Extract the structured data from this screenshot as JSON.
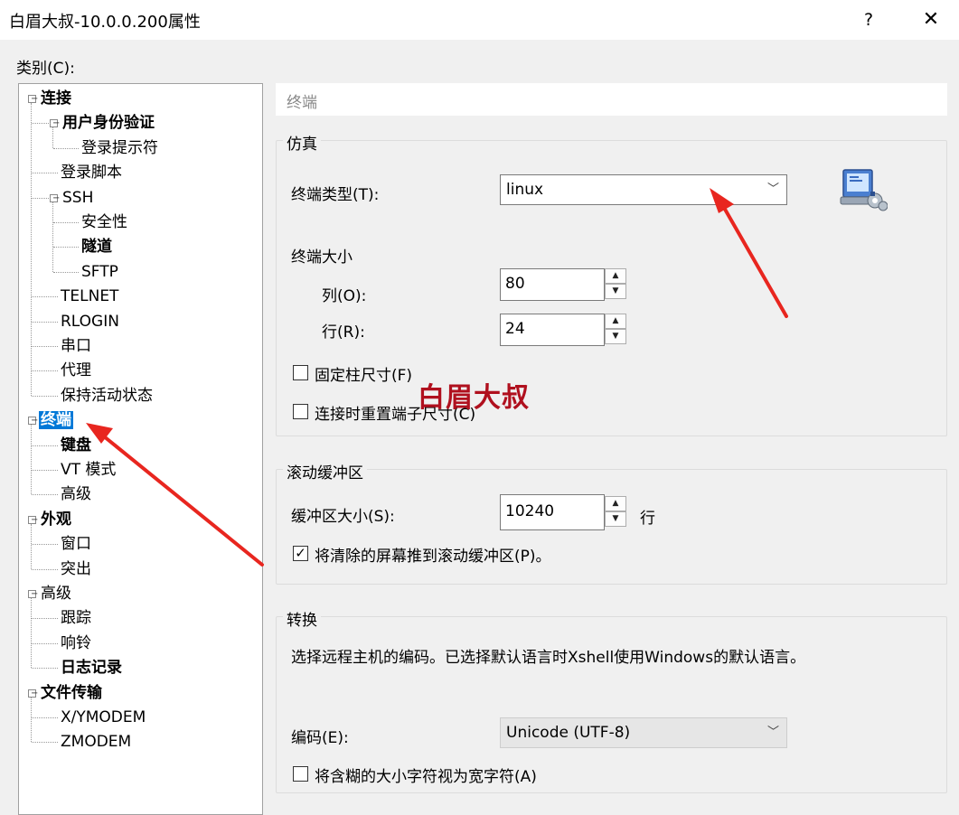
{
  "window": {
    "title": "白眉大叔-10.0.0.200属性",
    "help_label": "?",
    "close_label": "✕"
  },
  "category_label": "类别(C):",
  "tree": [
    {
      "label": "连接",
      "level": 0,
      "bold": true,
      "expander": "⊟"
    },
    {
      "label": "用户身份验证",
      "level": 1,
      "bold": true,
      "expander": "⊟"
    },
    {
      "label": "登录提示符",
      "level": 2,
      "bold": false
    },
    {
      "label": "登录脚本",
      "level": 1,
      "bold": false
    },
    {
      "label": "SSH",
      "level": 1,
      "bold": false,
      "expander": "⊟"
    },
    {
      "label": "安全性",
      "level": 2,
      "bold": false
    },
    {
      "label": "隧道",
      "level": 2,
      "bold": true
    },
    {
      "label": "SFTP",
      "level": 2,
      "bold": false
    },
    {
      "label": "TELNET",
      "level": 1,
      "bold": false
    },
    {
      "label": "RLOGIN",
      "level": 1,
      "bold": false
    },
    {
      "label": "串口",
      "level": 1,
      "bold": false
    },
    {
      "label": "代理",
      "level": 1,
      "bold": false
    },
    {
      "label": "保持活动状态",
      "level": 1,
      "bold": false
    },
    {
      "label": "终端",
      "level": 0,
      "bold": true,
      "expander": "⊟",
      "selected": true
    },
    {
      "label": "键盘",
      "level": 1,
      "bold": true
    },
    {
      "label": "VT 模式",
      "level": 1,
      "bold": false
    },
    {
      "label": "高级",
      "level": 1,
      "bold": false
    },
    {
      "label": "外观",
      "level": 0,
      "bold": true,
      "expander": "⊟"
    },
    {
      "label": "窗口",
      "level": 1,
      "bold": false
    },
    {
      "label": "突出",
      "level": 1,
      "bold": false
    },
    {
      "label": "高级",
      "level": 0,
      "bold": false,
      "expander": "⊟"
    },
    {
      "label": "跟踪",
      "level": 1,
      "bold": false
    },
    {
      "label": "响铃",
      "level": 1,
      "bold": false
    },
    {
      "label": "日志记录",
      "level": 1,
      "bold": true
    },
    {
      "label": "文件传输",
      "level": 0,
      "bold": true,
      "expander": "⊟"
    },
    {
      "label": "X/YMODEM",
      "level": 1,
      "bold": false
    },
    {
      "label": "ZMODEM",
      "level": 1,
      "bold": false
    }
  ],
  "panel": {
    "header": "终端",
    "emulation": {
      "group_title": "仿真",
      "terminal_type_label": "终端类型(T):",
      "terminal_type_value": "linux",
      "size_label": "终端大小",
      "cols_label": "列(O):",
      "cols_value": "80",
      "rows_label": "行(R):",
      "rows_value": "24",
      "fixed_cols_label": "固定柱尺寸(F)",
      "fixed_cols_checked": false,
      "reset_size_label": "连接时重置端子尺寸(C)",
      "reset_size_checked": false
    },
    "scrollback": {
      "group_title": "滚动缓冲区",
      "buffer_size_label": "缓冲区大小(S):",
      "buffer_size_value": "10240",
      "buffer_unit": "行",
      "push_cleared_label": "将清除的屏幕推到滚动缓冲区(P)。",
      "push_cleared_checked": true
    },
    "translation": {
      "group_title": "转换",
      "description": "选择远程主机的编码。已选择默认语言时Xshell使用Windows的默认语言。",
      "encoding_label": "编码(E):",
      "encoding_value": "Unicode (UTF-8)",
      "wide_char_label": "将含糊的大小字符视为宽字符(A)",
      "wide_char_checked": false
    }
  },
  "watermark": "白眉大叔",
  "colors": {
    "selection": "#0078d7",
    "annotation_arrow": "#e8261f",
    "watermark": "#b0101e"
  }
}
